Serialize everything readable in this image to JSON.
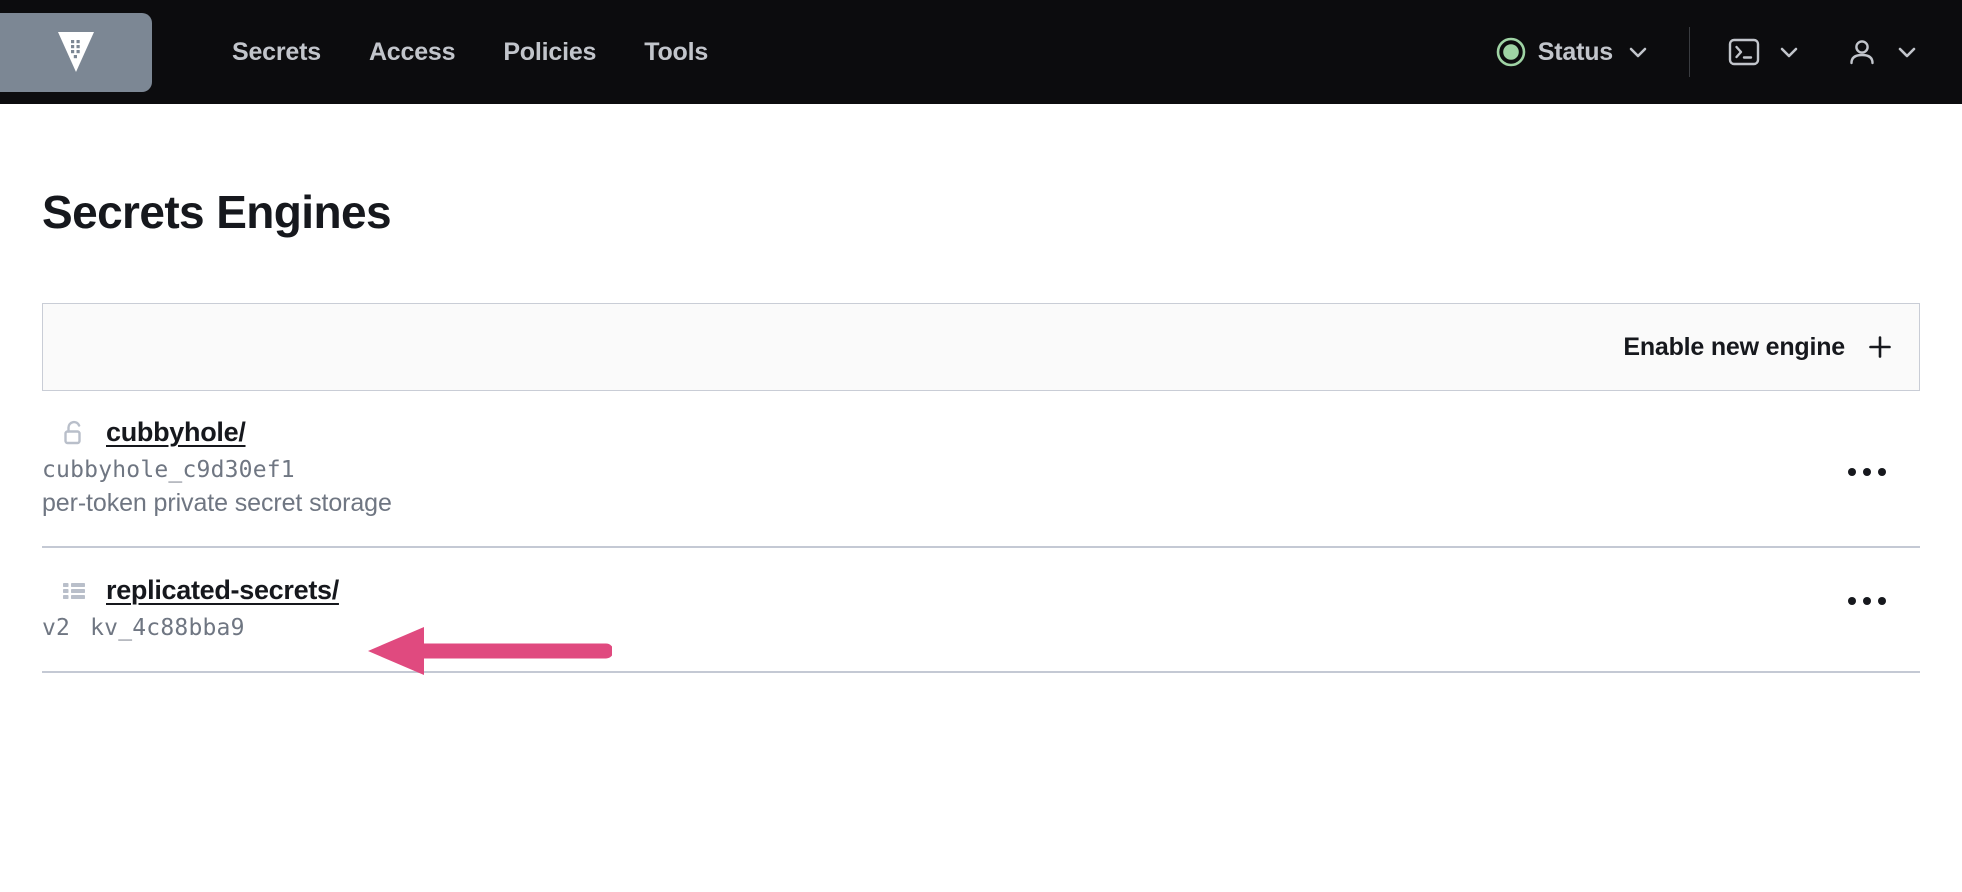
{
  "navbar": {
    "logo": {
      "icon": "vault-logo-icon",
      "alt": "Vault"
    },
    "links": [
      {
        "label": "Secrets",
        "name": "nav-link-secrets"
      },
      {
        "label": "Access",
        "name": "nav-link-access"
      },
      {
        "label": "Policies",
        "name": "nav-link-policies"
      },
      {
        "label": "Tools",
        "name": "nav-link-tools"
      }
    ],
    "status": {
      "label": "Status",
      "indicator_color": "#9fd3a4",
      "chevron": "chevron-down-icon"
    },
    "console": {
      "icon": "terminal-icon",
      "chevron": "chevron-down-icon"
    },
    "user": {
      "icon": "user-icon",
      "chevron": "chevron-down-icon"
    }
  },
  "main": {
    "title": "Secrets Engines",
    "toolbar": {
      "enable_label": "Enable new engine",
      "enable_icon": "plus-icon"
    },
    "engines": [
      {
        "icon": "unlock-icon",
        "path": "cubbyhole/",
        "version": "",
        "accessor": "cubbyhole_c9d30ef1",
        "description": "per-token private secret storage",
        "menu": "overflow-menu-icon"
      },
      {
        "icon": "kv-list-icon",
        "path": "replicated-secrets/",
        "version": "v2",
        "accessor": "kv_4c88bba9",
        "description": "",
        "menu": "overflow-menu-icon"
      }
    ]
  },
  "annotation": {
    "arrow": {
      "name": "highlight-arrow",
      "color": "#e04a7f",
      "direction": "left",
      "points_at": "replicated-secrets/"
    }
  },
  "colors": {
    "navbar_bg": "#0c0c0e",
    "logo_bg": "#7c8794",
    "nav_text": "#c2c5cb",
    "page_bg": "#ffffff",
    "card_bg": "#fafafa",
    "border": "#c9cdd6",
    "text_primary": "#16181d",
    "text_muted": "#6f7682",
    "accent_green": "#9fd3a4",
    "annotation_pink": "#e04a7f"
  }
}
